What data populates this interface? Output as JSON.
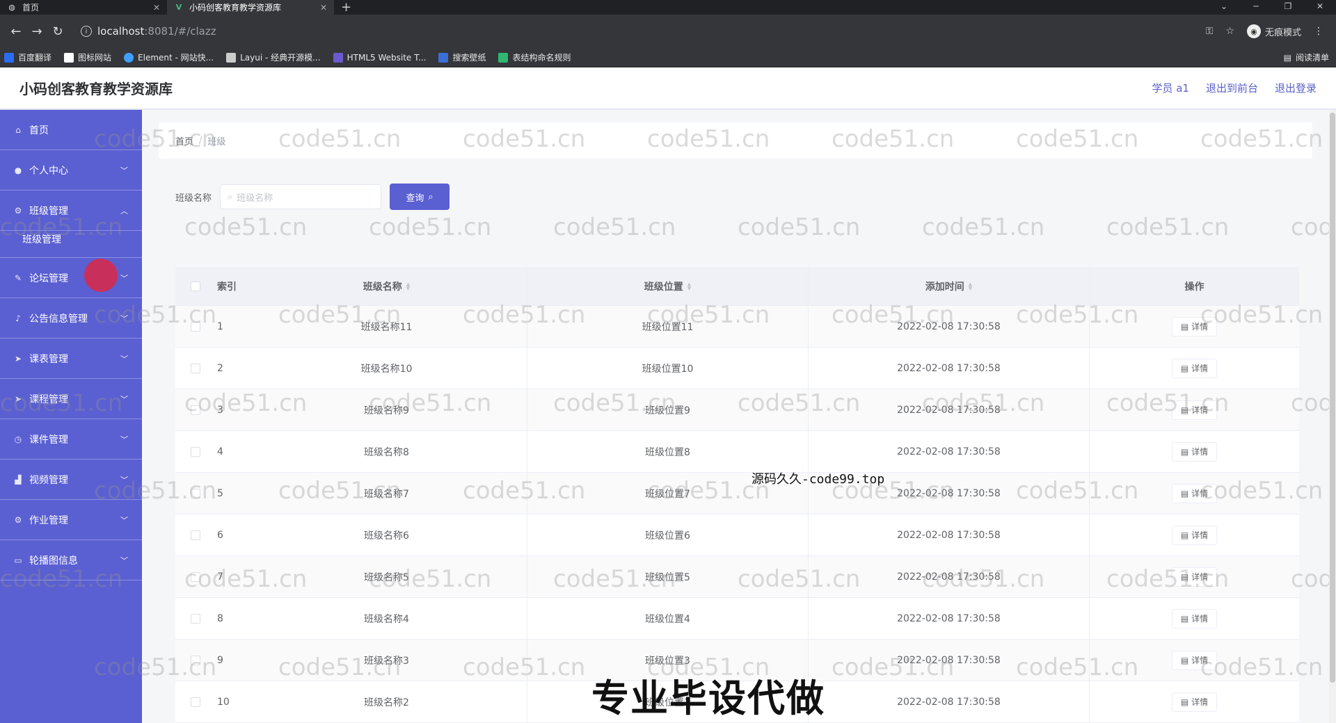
{
  "browser": {
    "tabs": [
      {
        "label": "首页",
        "icon": "globe-icon"
      },
      {
        "label": "小码创客教育教学资源库",
        "icon": "vue-icon"
      }
    ],
    "url_host": "localhost",
    "url_path": ":8081/#/clazz",
    "incognito_label": "无痕模式",
    "bookmarks": [
      {
        "label": "百度翻译",
        "color": "#2a6df4"
      },
      {
        "label": "图标网站",
        "color": "#ffffff"
      },
      {
        "label": "Element - 网站快...",
        "color": "#409eff"
      },
      {
        "label": "Layui - 经典开源模...",
        "color": "#cccccc"
      },
      {
        "label": "HTML5 Website T...",
        "color": "#6a5acd"
      },
      {
        "label": "搜索壁纸",
        "color": "#3b6fd8"
      },
      {
        "label": "表结构命名规则",
        "color": "#2eb872"
      }
    ],
    "reading_list": "阅读清单"
  },
  "header": {
    "title": "小码创客教育教学资源库",
    "user": "学员 a1",
    "back_front": "退出到前台",
    "logout": "退出登录"
  },
  "sidebar": {
    "items": [
      {
        "label": "首页",
        "icon": "home-icon"
      },
      {
        "label": "个人中心",
        "icon": "user-icon"
      },
      {
        "label": "班级管理",
        "icon": "gear-icon",
        "expanded": true,
        "children": [
          "班级管理"
        ]
      },
      {
        "label": "论坛管理",
        "icon": "edit-icon"
      },
      {
        "label": "公告信息管理",
        "icon": "bell-icon"
      },
      {
        "label": "课表管理",
        "icon": "send-icon"
      },
      {
        "label": "课程管理",
        "icon": "send-icon"
      },
      {
        "label": "课件管理",
        "icon": "clock-icon"
      },
      {
        "label": "视频管理",
        "icon": "chart-icon"
      },
      {
        "label": "作业管理",
        "icon": "setting-icon"
      },
      {
        "label": "轮播图信息",
        "icon": "monitor-icon"
      }
    ]
  },
  "breadcrumb": {
    "home": "首页",
    "current": "班级"
  },
  "search": {
    "label": "班级名称",
    "placeholder": "班级名称",
    "button": "查询"
  },
  "table": {
    "headers": {
      "index": "索引",
      "name": "班级名称",
      "position": "班级位置",
      "time": "添加时间",
      "op": "操作"
    },
    "detail_label": "详情",
    "rows": [
      {
        "index": "1",
        "name": "班级名称11",
        "position": "班级位置11",
        "time": "2022-02-08 17:30:58"
      },
      {
        "index": "2",
        "name": "班级名称10",
        "position": "班级位置10",
        "time": "2022-02-08 17:30:58"
      },
      {
        "index": "3",
        "name": "班级名称9",
        "position": "班级位置9",
        "time": "2022-02-08 17:30:58"
      },
      {
        "index": "4",
        "name": "班级名称8",
        "position": "班级位置8",
        "time": "2022-02-08 17:30:58"
      },
      {
        "index": "5",
        "name": "班级名称7",
        "position": "班级位置7",
        "time": "2022-02-08 17:30:58"
      },
      {
        "index": "6",
        "name": "班级名称6",
        "position": "班级位置6",
        "time": "2022-02-08 17:30:58"
      },
      {
        "index": "7",
        "name": "班级名称5",
        "position": "班级位置5",
        "time": "2022-02-08 17:30:58"
      },
      {
        "index": "8",
        "name": "班级名称4",
        "position": "班级位置4",
        "time": "2022-02-08 17:30:58"
      },
      {
        "index": "9",
        "name": "班级名称3",
        "position": "班级位置3",
        "time": "2022-02-08 17:30:58"
      },
      {
        "index": "10",
        "name": "班级名称2",
        "position": "班级位置2",
        "time": "2022-02-08 17:30:58"
      }
    ]
  },
  "overlays": {
    "watermark": "code51.cn",
    "caption_small": "源码久久-code99.top",
    "caption_large": "专业毕设代做"
  },
  "colors": {
    "primary": "#5a5fd1",
    "sidebar_bg": "#5a5fd1"
  }
}
